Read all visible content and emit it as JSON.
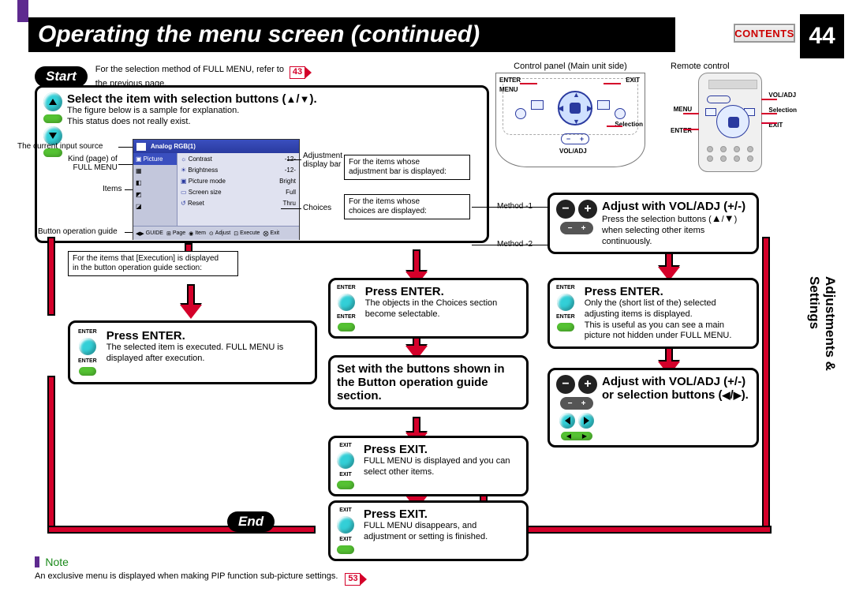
{
  "page": {
    "title": "Operating the menu screen (continued)",
    "contents_btn": "CONTENTS",
    "page_number": "44",
    "side_tab": "Adjustments &\nSettings"
  },
  "start": {
    "badge": "Start",
    "refer_text_a": "For the selection method of FULL MENU, refer to",
    "refer_text_b": "the previous page.",
    "ref_page": "43"
  },
  "diagrams": {
    "cp_title": "Control panel (Main unit side)",
    "rc_title": "Remote control",
    "labels": {
      "enter": "ENTER",
      "exit": "EXIT",
      "menu": "MENU",
      "selection": "Selection",
      "voladj": "VOL/ADJ"
    }
  },
  "step1": {
    "heading_a": "Select the item with selection buttons (",
    "heading_b": ").",
    "note1": "The figure below is a sample for explanation.",
    "note2": "This status does not really exist."
  },
  "menu_sample": {
    "leaders": {
      "current_input": "The current input source",
      "kind_page": "Kind (page) of\nFULL MENU",
      "items": "Items",
      "button_guide": "Button operation guide",
      "adj_bar": "Adjustment\ndisplay bar",
      "choices": "Choices"
    },
    "titlebar": "Analog RGB(1)",
    "left_tabs": [
      "Picture",
      "",
      "",
      "",
      ""
    ],
    "rows": [
      {
        "icon": "☼",
        "name": "Contrast",
        "val": "-12-"
      },
      {
        "icon": "☀",
        "name": "Brightness",
        "val": "-12-"
      },
      {
        "icon": "▣",
        "name": "Picture mode",
        "val": "Bright"
      },
      {
        "icon": "▭",
        "name": "Screen size",
        "val": "Full"
      },
      {
        "icon": "↺",
        "name": "Reset",
        "val": "Thru"
      }
    ],
    "status": {
      "guide": "GUIDE",
      "adjust": "Adjust",
      "page": "Page",
      "execute": "Execute",
      "item": "Item",
      "exit": "Exit"
    }
  },
  "branch_exec": {
    "box": "For the items that [Execution] is displayed\nin the button operation guide section:",
    "enter_heading": "Press ENTER.",
    "enter_desc": "The selected item is executed.  FULL MENU is displayed after execution."
  },
  "branch_middle": {
    "adj_bar_box": "For the items whose\nadjustment bar is displayed:",
    "choices_box": "For the items whose\nchoices are displayed:",
    "method1": "Method -1",
    "method2": "Method -2",
    "enter_heading": "Press ENTER.",
    "enter_desc": "The objects in the Choices section become selectable.",
    "set_heading": "Set with the buttons shown in the Button operation guide section.",
    "exit1_heading": "Press EXIT.",
    "exit1_desc": "FULL MENU is displayed and you can select other items.",
    "exit2_heading": "Press EXIT.",
    "exit2_desc": "FULL MENU disappears, and adjustment or setting is finished."
  },
  "branch_right": {
    "voladj_heading": "Adjust with VOL/ADJ (+/-)",
    "voladj_desc_a": "Press the selection buttons (",
    "voladj_desc_b": ") when selecting other items continuously.",
    "enter_heading": "Press ENTER.",
    "enter_desc": "Only the (short list of the) selected adjusting items is displayed.\nThis is useful as you can see a main picture not hidden under FULL MENU.",
    "adj2_heading_a": "Adjust with VOL/ADJ (+/-) or selection buttons (",
    "adj2_heading_b": ")."
  },
  "end_badge": "End",
  "note": {
    "label": "Note",
    "text": "An exclusive menu is displayed when making PIP function sub-picture settings.",
    "ref_page": "53"
  },
  "icons": {
    "enter": "ENTER",
    "exit": "EXIT"
  }
}
